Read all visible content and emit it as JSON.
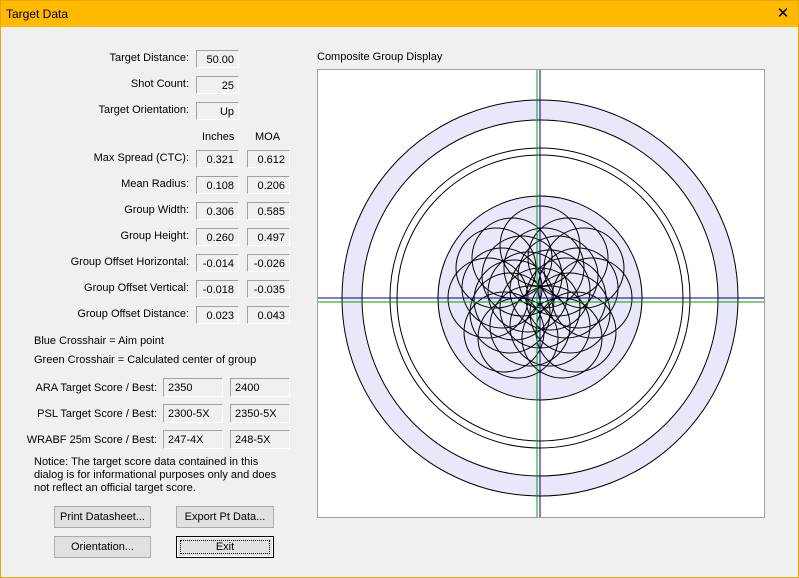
{
  "window": {
    "title": "Target Data",
    "close_icon": "close-icon"
  },
  "left": {
    "target_distance": {
      "label": "Target Distance:",
      "value": "50.00"
    },
    "shot_count": {
      "label": "Shot Count:",
      "value": "25"
    },
    "target_orientation": {
      "label": "Target Orientation:",
      "value": "Up"
    },
    "col_inches": "Inches",
    "col_moa": "MOA",
    "stats": [
      {
        "label": "Max Spread (CTC):",
        "inches": "0.321",
        "moa": "0.612"
      },
      {
        "label": "Mean Radius:",
        "inches": "0.108",
        "moa": "0.206"
      },
      {
        "label": "Group Width:",
        "inches": "0.306",
        "moa": "0.585"
      },
      {
        "label": "Group Height:",
        "inches": "0.260",
        "moa": "0.497"
      },
      {
        "label": "Group Offset Horizontal:",
        "inches": "-0.014",
        "moa": "-0.026"
      },
      {
        "label": "Group Offset Vertical:",
        "inches": "-0.018",
        "moa": "-0.035"
      },
      {
        "label": "Group Offset Distance:",
        "inches": "0.023",
        "moa": "0.043"
      }
    ],
    "legend_blue": "Blue Crosshair = Aim point",
    "legend_green": "Green Crosshair = Calculated center of group",
    "scores": [
      {
        "label": "ARA Target Score / Best:",
        "score": "2350",
        "best": "2400"
      },
      {
        "label": "PSL Target Score / Best:",
        "score": "2300-5X",
        "best": "2350-5X"
      },
      {
        "label": "WRABF 25m Score / Best:",
        "score": "247-4X",
        "best": "248-5X"
      }
    ],
    "notice_lines": [
      "Notice: The target score data contained in this",
      "dialog is for informational purposes only and does",
      "not reflect an official target score."
    ]
  },
  "buttons": {
    "print": "Print Datasheet...",
    "export": "Export Pt Data...",
    "orientation": "Orientation...",
    "exit": "Exit"
  },
  "display": {
    "title": "Composite Group Display",
    "ring_fill_color": "#e8e8fa",
    "aim_color": "#000080",
    "center_color": "#00a000"
  }
}
